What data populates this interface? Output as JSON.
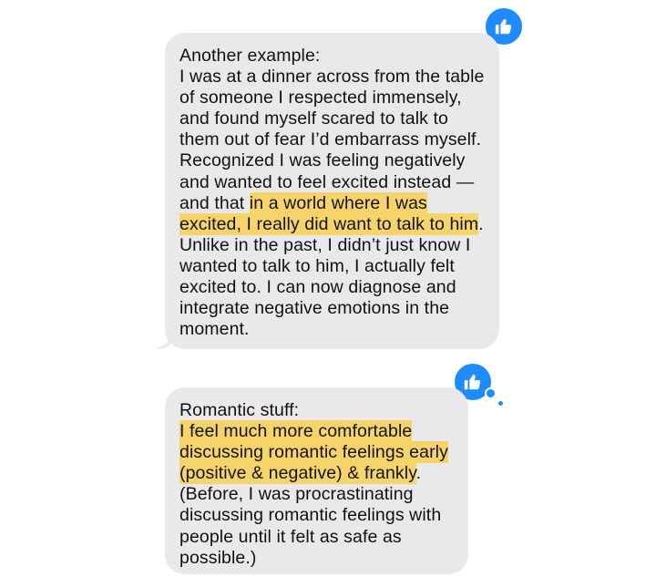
{
  "messages": [
    {
      "lines": [
        {
          "text": "Another example:"
        },
        {
          "text": "I was at a dinner across from the table"
        },
        {
          "text": "of someone I respected immensely,"
        },
        {
          "text": "and found myself scared to talk to"
        },
        {
          "text": "them out of fear I’d embarrass myself."
        },
        {
          "text": "Recognized I was feeling negatively"
        },
        {
          "text": "and wanted to feel excited instead —"
        },
        {
          "pre": "and that ",
          "highlight": "in a world where I was",
          "post": ""
        },
        {
          "pre": "",
          "highlight": "excited, I really did want to talk to him",
          "post": "."
        },
        {
          "text": "Unlike in the past, I didn’t just know I"
        },
        {
          "text": "wanted to talk to him, I actually felt"
        },
        {
          "text": "excited to. I can now diagnose and"
        },
        {
          "text": "integrate negative emotions in the"
        },
        {
          "text": "moment."
        }
      ],
      "reaction": "thumbs-up-icon"
    },
    {
      "lines": [
        {
          "text": "Romantic stuff:"
        },
        {
          "pre": "",
          "highlight": "I feel much more comfortable",
          "post": ""
        },
        {
          "pre": "",
          "highlight": "discussing romantic feelings early",
          "post": ""
        },
        {
          "pre": "",
          "highlight": "(positive & negative) & frankly",
          "post": "."
        },
        {
          "text": "(Before, I was procrastinating"
        },
        {
          "text": "discussing romantic feelings with"
        },
        {
          "text": "people until it felt as safe as"
        },
        {
          "text": "possible.)"
        }
      ],
      "reaction": "thumbs-up-icon"
    }
  ],
  "colors": {
    "bubble": "#e9e9eb",
    "highlight": "#f7d46a",
    "reaction": "#1e8bff"
  }
}
